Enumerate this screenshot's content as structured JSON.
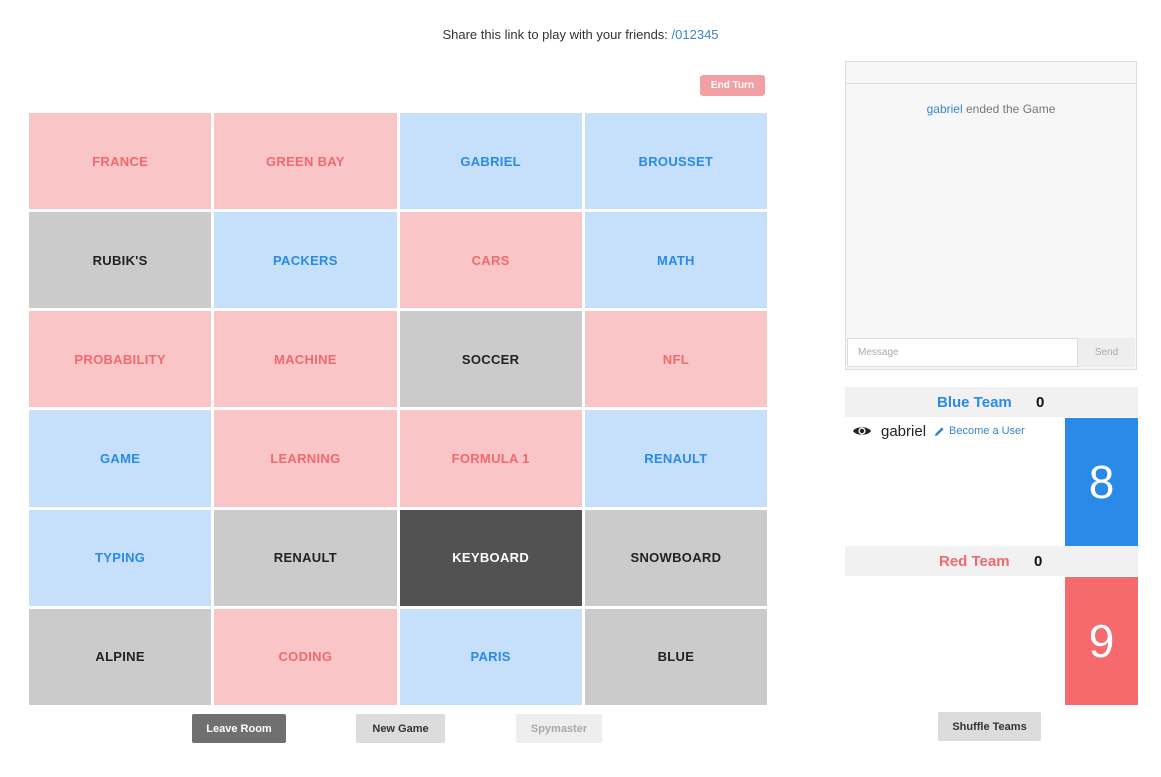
{
  "share": {
    "text": "Share this link to play with your friends:",
    "link": "/012345"
  },
  "end_turn_label": "End Turn",
  "cards": [
    {
      "word": "FRANCE",
      "team": "red"
    },
    {
      "word": "GREEN BAY",
      "team": "red"
    },
    {
      "word": "GABRIEL",
      "team": "blue"
    },
    {
      "word": "BROUSSET",
      "team": "blue"
    },
    {
      "word": "RUBIK'S",
      "team": "neutral"
    },
    {
      "word": "PACKERS",
      "team": "blue"
    },
    {
      "word": "CARS",
      "team": "red"
    },
    {
      "word": "MATH",
      "team": "blue"
    },
    {
      "word": "PROBABILITY",
      "team": "red"
    },
    {
      "word": "MACHINE",
      "team": "red"
    },
    {
      "word": "SOCCER",
      "team": "neutral"
    },
    {
      "word": "NFL",
      "team": "red"
    },
    {
      "word": "GAME",
      "team": "blue"
    },
    {
      "word": "LEARNING",
      "team": "red"
    },
    {
      "word": "FORMULA 1",
      "team": "red"
    },
    {
      "word": "RENAULT",
      "team": "blue"
    },
    {
      "word": "TYPING",
      "team": "blue"
    },
    {
      "word": "RENAULT",
      "team": "neutral"
    },
    {
      "word": "KEYBOARD",
      "team": "assassin"
    },
    {
      "word": "SNOWBOARD",
      "team": "neutral"
    },
    {
      "word": "ALPINE",
      "team": "neutral"
    },
    {
      "word": "CODING",
      "team": "red"
    },
    {
      "word": "PARIS",
      "team": "blue"
    },
    {
      "word": "BLUE",
      "team": "neutral"
    }
  ],
  "buttons": {
    "leave_room": "Leave Room",
    "new_game": "New Game",
    "spymaster": "Spymaster",
    "shuffle_teams": "Shuffle Teams"
  },
  "chat": {
    "log_user": "gabriel",
    "log_text": " ended the Game",
    "input_placeholder": "Message",
    "send_label": "Send"
  },
  "blue_team": {
    "name": "Blue Team",
    "count": "0",
    "score": "8",
    "color": "#2a8ae8"
  },
  "red_team": {
    "name": "Red Team",
    "count": "0",
    "score": "9",
    "color": "#f66a6e"
  },
  "player": {
    "name": "gabriel",
    "action": "Become a User"
  },
  "colors": {
    "red_card_bg": "#f9c5c7",
    "red_card_text": "#f06a6e",
    "blue_card_bg": "#c6e0fb",
    "blue_card_text": "#2a8ae8",
    "neutral_card_bg": "#cbcbcb",
    "assassin_card_bg": "#525252"
  }
}
